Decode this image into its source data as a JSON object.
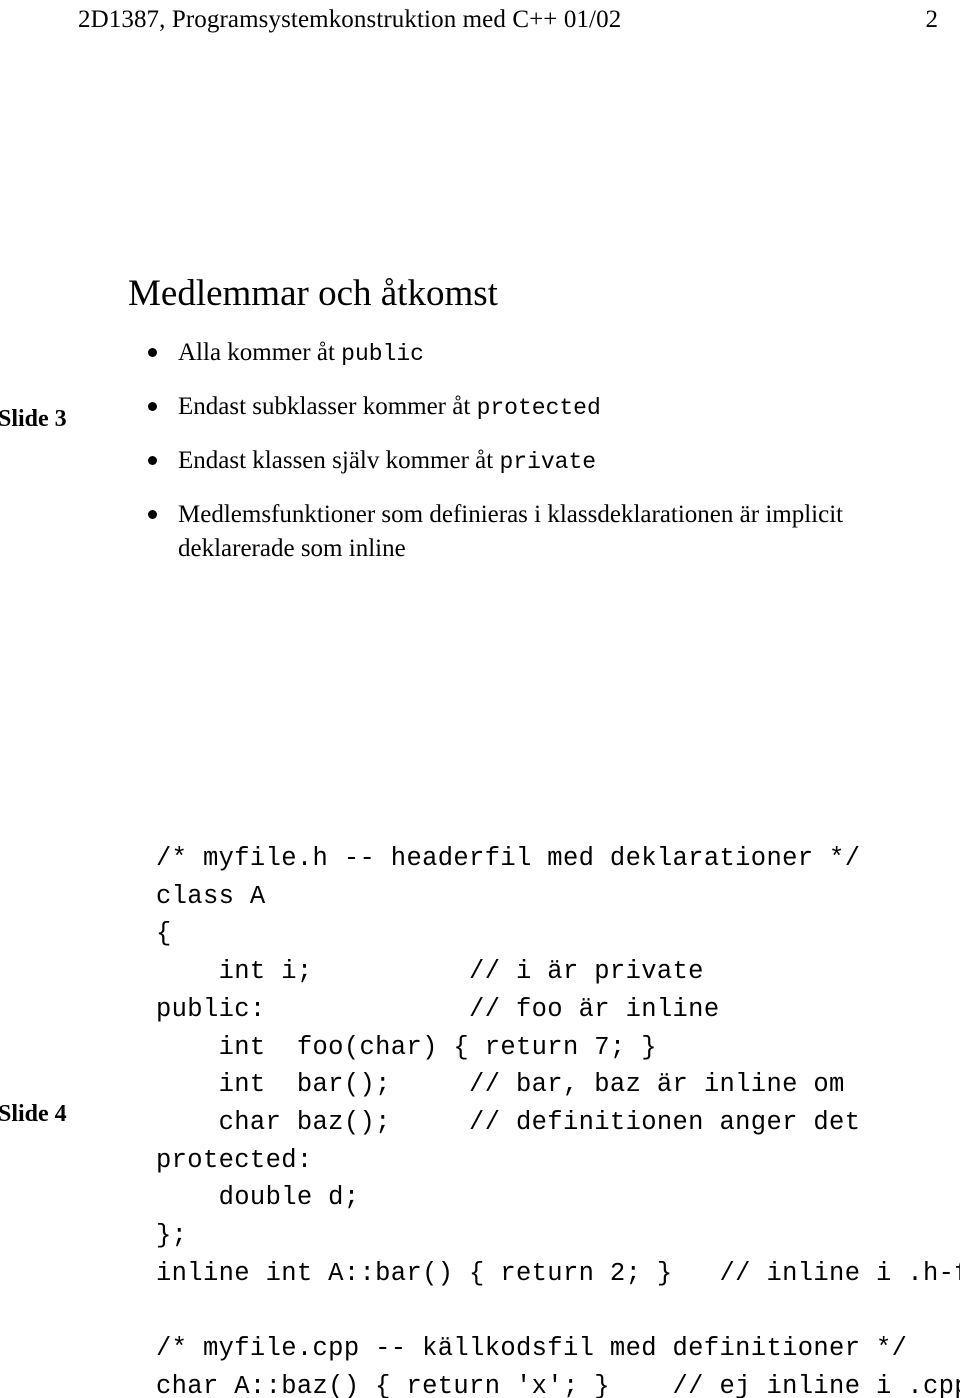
{
  "header": {
    "course_title": "2D1387, Programsystemkonstruktion med C++ 01/02",
    "page_number": "2"
  },
  "margin_labels": {
    "slide3": "Slide 3",
    "slide4": "Slide 4"
  },
  "slide3": {
    "title": "Medlemmar och åtkomst",
    "bullets": [
      {
        "segments": [
          {
            "text": "Alla kommer åt ",
            "style": "serif"
          },
          {
            "text": "public",
            "style": "mono"
          }
        ]
      },
      {
        "segments": [
          {
            "text": "Endast subklasser kommer åt ",
            "style": "serif"
          },
          {
            "text": "protected",
            "style": "mono"
          }
        ]
      },
      {
        "segments": [
          {
            "text": "Endast klassen själv kommer åt ",
            "style": "serif"
          },
          {
            "text": "private",
            "style": "mono"
          }
        ]
      },
      {
        "segments": [
          {
            "text": "Medlemsfunktioner som definieras i klassdeklarationen är implicit deklarerade som inline",
            "style": "serif"
          }
        ]
      }
    ]
  },
  "slide4": {
    "code": "/* myfile.h -- headerfil med deklarationer */\nclass A\n{\n    int i;          // i är private\npublic:             // foo är inline\n    int  foo(char) { return 7; }\n    int  bar();     // bar, baz är inline om\n    char baz();     // definitionen anger det\nprotected:\n    double d;\n};\ninline int A::bar() { return 2; }   // inline i .h-fil\n\n/* myfile.cpp -- källkodsfil med definitioner */\nchar A::baz() { return 'x'; }    // ej inline i .cpp-fil"
  },
  "colors": {
    "page_background": "#ffffff",
    "text": "#000000"
  }
}
